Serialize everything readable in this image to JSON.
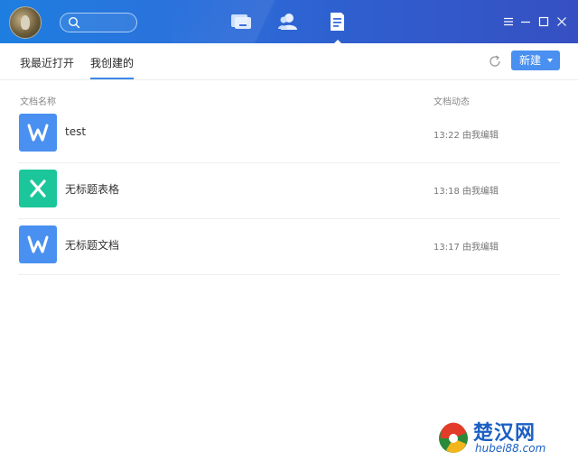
{
  "header": {
    "nav": [
      {
        "name": "chat-icon"
      },
      {
        "name": "contacts-icon"
      },
      {
        "name": "documents-icon",
        "active": true
      }
    ],
    "window_controls": [
      "menu-icon",
      "minimize-icon",
      "maximize-icon",
      "close-icon"
    ]
  },
  "tabs": {
    "recent": "我最近打开",
    "created": "我创建的",
    "active": "created"
  },
  "toolbar": {
    "new_label": "新建"
  },
  "columns": {
    "name": "文档名称",
    "activity": "文档动态"
  },
  "files": [
    {
      "name": "test",
      "time": "13:22",
      "action": "由我编辑",
      "type": "W",
      "color": "#4a90f0"
    },
    {
      "name": "无标题表格",
      "time": "13:18",
      "action": "由我编辑",
      "type": "X",
      "color": "#1bc69a"
    },
    {
      "name": "无标题文档",
      "time": "13:17",
      "action": "由我编辑",
      "type": "W",
      "color": "#4a90f0"
    }
  ],
  "watermark": {
    "brand": "楚汉网",
    "url": "hubei88.com"
  }
}
